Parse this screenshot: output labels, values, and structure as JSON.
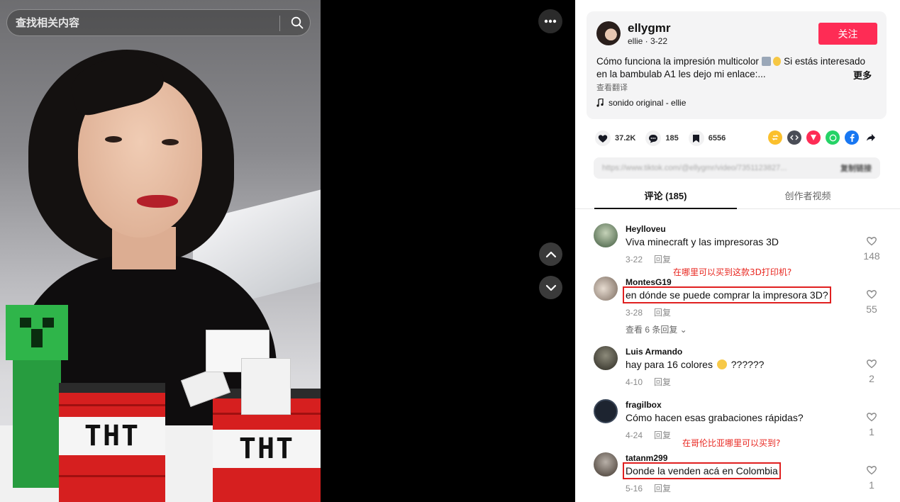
{
  "search": {
    "placeholder": "查找相关内容"
  },
  "author": {
    "handle": "ellygmr",
    "display_name": "ellie",
    "date": "3-22",
    "subline": "ellie · 3-22",
    "follow_label": "关注"
  },
  "caption": {
    "line1": "Cómo funciona la impresión multicolor",
    "line1_rest": "Si estás interesado",
    "line2": "en la bambulab A1 les dejo mi enlace:...",
    "more_label": "更多",
    "translate_label": "查看翻译",
    "sound": "sonido original - ellie"
  },
  "actions": {
    "likes": "37.2K",
    "comments": "185",
    "saves": "6556"
  },
  "share_icons": [
    "repost-icon",
    "embed-icon",
    "send-icon",
    "whatsapp-icon",
    "facebook-icon",
    "share-arrow-icon"
  ],
  "colors": {
    "accent": "#fe2c55",
    "annotation": "#e8261f"
  },
  "link": {
    "url": "https://www.tiktok.com/@ellygmr/video/7351123827...",
    "copy_label": "复制链接"
  },
  "tabs": [
    {
      "label": "评论 (185)"
    },
    {
      "label": "创作者视频"
    }
  ],
  "comments": [
    {
      "user": "Heylloveu",
      "text": "Viva minecraft y las impresoras 3D",
      "date": "3-22",
      "reply_label": "回复",
      "likes": "148"
    },
    {
      "user": "MontesG19",
      "text": "en dónde se puede comprar la impresora 3D?",
      "date": "3-28",
      "reply_label": "回复",
      "likes": "55",
      "view_replies": "查看 6 条回复 ⌄",
      "annotation": "在哪里可以买到这款3D打印机?"
    },
    {
      "user": "Luis Armando",
      "text": "hay para 16 colores",
      "text_rest": "??????",
      "date": "4-10",
      "reply_label": "回复",
      "likes": "2"
    },
    {
      "user": "fragilbox",
      "text": "Cómo hacen esas grabaciones rápidas?",
      "date": "4-24",
      "reply_label": "回复",
      "likes": "1",
      "annotation": "在哥伦比亚哪里可以买到?"
    },
    {
      "user": "tatanm299",
      "text": "Donde la venden acá en Colombia",
      "date": "5-16",
      "reply_label": "回复",
      "likes": "1"
    }
  ],
  "video": {
    "tnt_label_1": "THT",
    "tnt_label_2": "THT"
  }
}
